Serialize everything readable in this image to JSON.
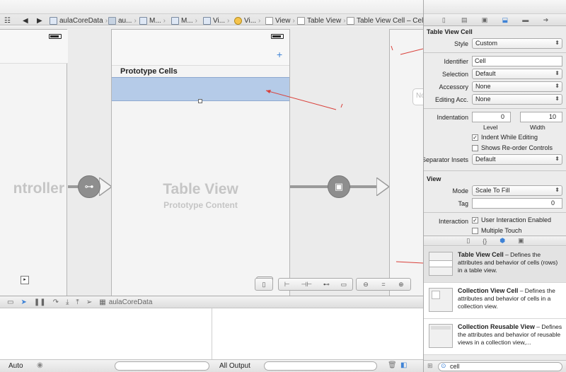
{
  "jumpbar": {
    "items": [
      {
        "label": "aulaCoreData",
        "icon": "project-icon"
      },
      {
        "label": "au...",
        "icon": "folder-icon"
      },
      {
        "label": "M...",
        "icon": "storyboard-icon"
      },
      {
        "label": "M...",
        "icon": "scene-icon"
      },
      {
        "label": "Vi...",
        "icon": "scene-icon"
      },
      {
        "label": "Vi...",
        "icon": "view-controller-icon"
      },
      {
        "label": "View",
        "icon": "view-icon"
      },
      {
        "label": "Table View",
        "icon": "table-view-icon"
      },
      {
        "label": "Table View Cell – Cell",
        "icon": "table-cell-icon"
      }
    ]
  },
  "canvas": {
    "left_scene_title": "ntroller",
    "prototype_header": "Prototype Cells",
    "add_symbol": "+",
    "table_view_title": "Table View",
    "table_view_subtitle": "Prototype Content",
    "right_scene_placeholder": "No"
  },
  "debug": {
    "scheme_label": "aulaCoreData",
    "auto_label": "Auto",
    "output_label": "All Output"
  },
  "inspector": {
    "section_cell": "Table View Cell",
    "style_label": "Style",
    "style_value": "Custom",
    "identifier_label": "Identifier",
    "identifier_value": "Cell",
    "selection_label": "Selection",
    "selection_value": "Default",
    "accessory_label": "Accessory",
    "accessory_value": "None",
    "editing_acc_label": "Editing Acc.",
    "editing_acc_value": "None",
    "indentation_label": "Indentation",
    "indent_level": "0",
    "indent_width": "10",
    "level_label": "Level",
    "width_label": "Width",
    "indent_while_editing": "Indent While Editing",
    "shows_reorder": "Shows Re-order Controls",
    "separator_label": "Separator Insets",
    "separator_value": "Default",
    "section_view": "View",
    "mode_label": "Mode",
    "mode_value": "Scale To Fill",
    "tag_label": "Tag",
    "tag_value": "0",
    "interaction_label": "Interaction",
    "user_interaction": "User Interaction Enabled",
    "multiple_touch": "Multiple Touch"
  },
  "library": {
    "items": [
      {
        "title": "Table View Cell",
        "desc": " – Defines the attributes and behavior of cells (rows) in a table view."
      },
      {
        "title": "Collection View Cell",
        "desc": " – Defines the attributes and behavior of cells in a collection view."
      },
      {
        "title": "Collection Reusable View",
        "desc": " – Defines the attributes and behavior of reusable views in a collection view,..."
      }
    ],
    "search_value": "cell"
  },
  "colors": {
    "selected_cell": "#b5cbe8",
    "annotation_arrow": "#d9403a",
    "accent": "#3f83d6"
  }
}
